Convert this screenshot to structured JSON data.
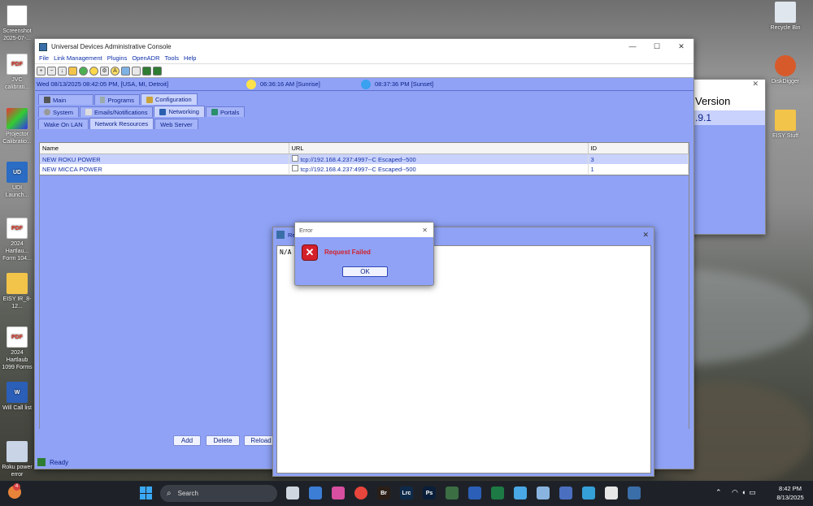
{
  "desktop": {
    "left_icons": [
      {
        "label": "Screenshot 2025-07-...",
        "icon": "screenshot-file-icon"
      },
      {
        "label": "JVC calibrati...",
        "icon": "pdf-icon"
      },
      {
        "label": "Projector Calibratio...",
        "icon": "app-icon"
      },
      {
        "label": "UDI Launch...",
        "icon": "ud-launcher-icon"
      },
      {
        "label": "2024 Hartlau... Form 104...",
        "icon": "pdf-icon"
      },
      {
        "label": "EISY IR_8-12...",
        "icon": "folder-icon"
      },
      {
        "label": "2024 Hartlaub 1099 Forms",
        "icon": "pdf-icon"
      },
      {
        "label": "Will Call list",
        "icon": "word-icon"
      },
      {
        "label": "Roku power error",
        "icon": "printer-icon"
      }
    ],
    "right_icons": [
      {
        "label": "Recycle Bin",
        "icon": "recycle-bin-icon"
      },
      {
        "label": "DiskDigger",
        "icon": "diskdigger-icon"
      },
      {
        "label": "EISY Stuff",
        "icon": "folder-icon"
      }
    ]
  },
  "background_window": {
    "version_label": "Version",
    "version_value": ".9.1"
  },
  "main_window": {
    "title": "Universal Devices Administrative Console",
    "window_controls": [
      "—",
      "☐",
      "✕"
    ],
    "menu": [
      "File",
      "Link Management",
      "Plugins",
      "OpenADR",
      "Tools",
      "Help"
    ],
    "info": {
      "datetime": "Wed 08/13/2025 08:42:05 PM,  [USA, MI, Detroit]",
      "sunrise": "06:36:16 AM [Sunrise]",
      "sunset": "08:37:36 PM [Sunset]"
    },
    "tabs_level1": [
      "Main",
      "Programs",
      "Configuration"
    ],
    "tabs_level2": [
      "System",
      "Emails/Notifications",
      "Networking",
      "Portals"
    ],
    "tabs_level3": [
      "Wake On LAN",
      "Network Resources",
      "Web Server"
    ],
    "table": {
      "columns": [
        "Name",
        "URL",
        "ID"
      ],
      "rows": [
        {
          "name": "NEW ROKU POWER",
          "url": "tcp://192.168.4.237:4997--C Escaped--500",
          "id": "3"
        },
        {
          "name": "NEW MICCA POWER",
          "url": "tcp://192.168.4.237:4997--C Escaped--500",
          "id": "1"
        }
      ]
    },
    "buttons": {
      "add": "Add",
      "delete": "Delete",
      "reload": "Reload"
    },
    "status": "Ready"
  },
  "result_window": {
    "title": "Re",
    "content": "N/A",
    "close": "✕"
  },
  "error_dialog": {
    "title": "Error",
    "close": "✕",
    "message": "Request Failed",
    "ok": "OK"
  },
  "taskbar": {
    "search_placeholder": "Search",
    "notification_badge": "4",
    "apps": [
      "Br",
      "Lrc",
      "Ps"
    ],
    "time": "8:42 PM",
    "date": "8/13/2025"
  },
  "colors": {
    "accent_blue": "#8fa2f5",
    "text_blue": "#0a1f88",
    "error_red": "#d4202a"
  }
}
